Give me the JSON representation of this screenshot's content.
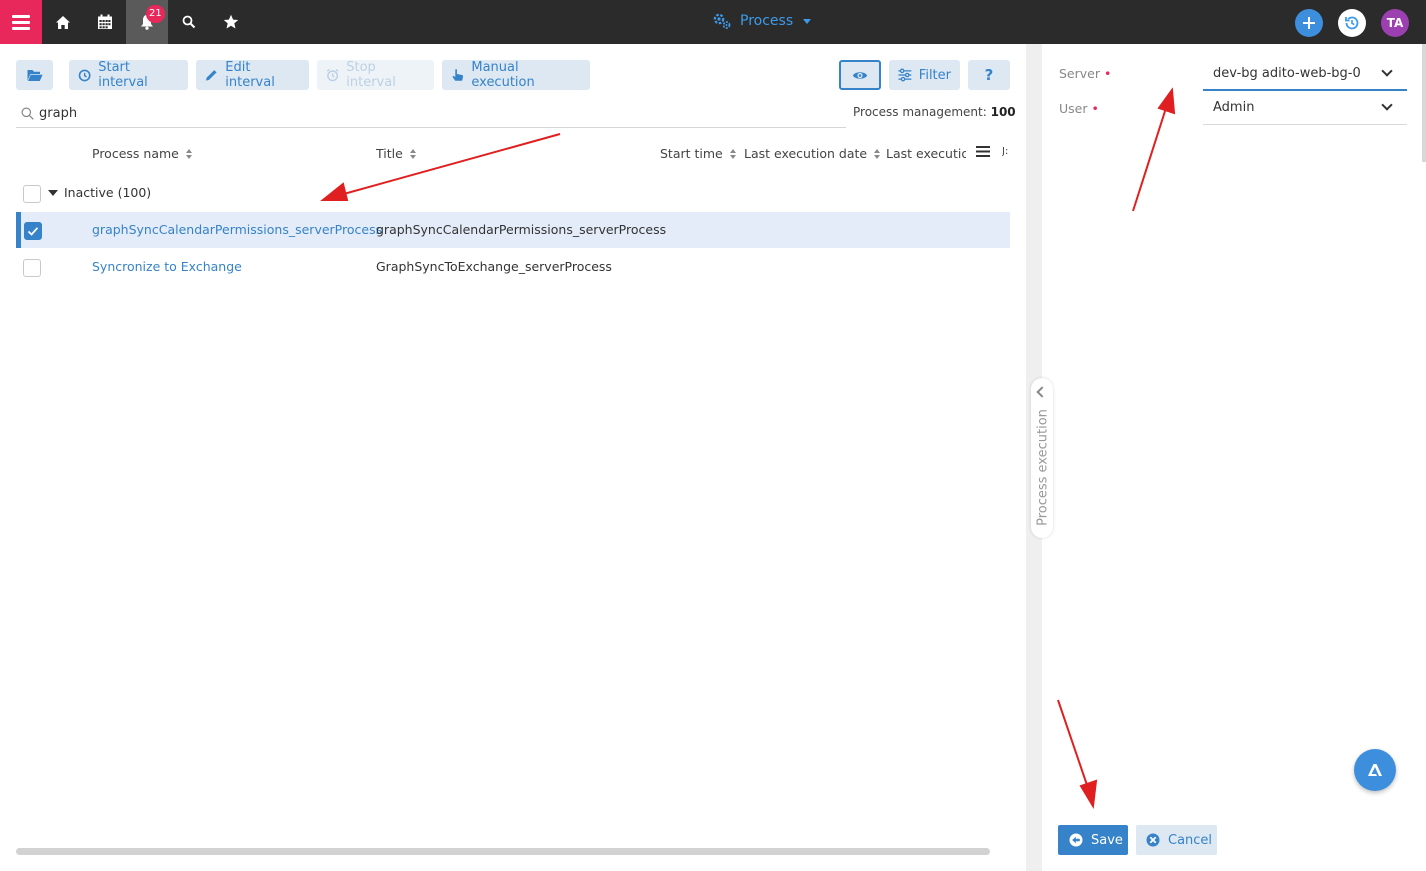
{
  "topbar": {
    "notification_count": "21",
    "module_title": "Process",
    "user_initials": "TA",
    "colors": {
      "bar": "#2b2b2b",
      "menu": "#e8275a",
      "accent": "#3d9be9",
      "avatar": "#9c3fb0"
    }
  },
  "toolbar": {
    "start_interval": "Start interval",
    "edit_interval": "Edit interval",
    "stop_interval": "Stop interval",
    "manual_execution": "Manual execution",
    "filter": "Filter",
    "help": "?"
  },
  "search": {
    "value": "graph"
  },
  "summary": {
    "label": "Process management:",
    "count": "100"
  },
  "grid": {
    "columns": [
      "Process name",
      "Title",
      "Start time",
      "Last execution date",
      "Last executio",
      "J:"
    ],
    "group": {
      "label": "Inactive (100)"
    },
    "rows": [
      {
        "name": "graphSyncCalendarPermissions_serverProcess",
        "title": "graphSyncCalendarPermissions_serverProcess",
        "selected": true
      },
      {
        "name": "Syncronize to Exchange",
        "title": "GraphSyncToExchange_serverProcess",
        "selected": false
      }
    ]
  },
  "side_panel": {
    "tab_label": "Process execution",
    "server": {
      "label": "Server",
      "value": "dev-bg adito-web-bg-0"
    },
    "user": {
      "label": "User",
      "value": "Admin"
    },
    "save": "Save",
    "cancel": "Cancel"
  }
}
